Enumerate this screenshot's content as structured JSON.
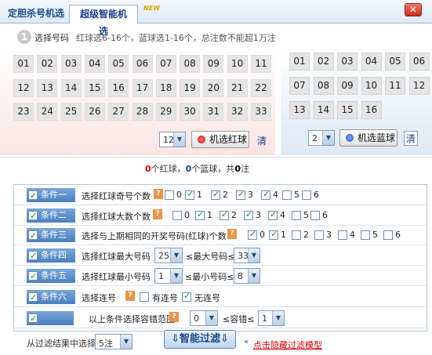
{
  "tabs": {
    "tab1": "定胆杀号机选",
    "tab2": "超级智能机选",
    "new_badge": "NEW"
  },
  "step": {
    "number": "1",
    "title": "选择号码",
    "desc": "红球选6-16个，蓝球选1-16个，总注数不能超1万注"
  },
  "red_balls": [
    "01",
    "02",
    "03",
    "04",
    "05",
    "06",
    "07",
    "08",
    "09",
    "10",
    "11",
    "12",
    "13",
    "14",
    "15",
    "16",
    "17",
    "18",
    "19",
    "20",
    "21",
    "22",
    "23",
    "24",
    "25",
    "26",
    "27",
    "28",
    "29",
    "30",
    "31",
    "32",
    "33"
  ],
  "blue_balls": [
    "01",
    "02",
    "03",
    "04",
    "05",
    "06",
    "07",
    "08",
    "09",
    "10",
    "11",
    "12",
    "13",
    "14",
    "15",
    "16"
  ],
  "red_select": {
    "value": "12",
    "button": "机选红球",
    "clear": "清"
  },
  "blue_select": {
    "value": "2",
    "button": "机选蓝球",
    "clear": "清"
  },
  "summary": {
    "red_count": "0",
    "red_label": "个红球，",
    "blue_count": "0",
    "blue_label": "个篮球，共",
    "total": "0",
    "unit": "注"
  },
  "conditions": [
    {
      "tag": "条件一",
      "text": "选择红球奇号个数",
      "options": [
        "0",
        "1",
        "2",
        "3",
        "4",
        "5",
        "6"
      ],
      "checked": [
        false,
        true,
        true,
        true,
        true,
        false,
        false
      ]
    },
    {
      "tag": "条件二",
      "text": "选择红球大数个数",
      "options": [
        "0",
        "1",
        "2",
        "3",
        "4",
        "5",
        "6"
      ],
      "checked": [
        false,
        true,
        true,
        true,
        true,
        false,
        false
      ]
    },
    {
      "tag": "条件三",
      "text": "选择与上期相同的开奖号码(红球)个数",
      "options": [
        "0",
        "1",
        "2",
        "3",
        "4",
        "5",
        "6"
      ],
      "checked": [
        true,
        true,
        false,
        false,
        false,
        false,
        false
      ]
    },
    {
      "tag": "条件四",
      "text": "选择红球最大号码",
      "min": "25",
      "mid": "≤最大号码≤",
      "max": "33"
    },
    {
      "tag": "条件五",
      "text": "选择红球最小号码",
      "min": "1",
      "mid": "≤最小号码≤",
      "max": "8"
    },
    {
      "tag": "条件六",
      "text": "选择连号",
      "opt_a": "有连号",
      "opt_b": "无连号"
    },
    {
      "text": "以上条件选择容错范围",
      "min": "0",
      "mid": "≤容错≤",
      "max": "1"
    }
  ],
  "help_mark": "?",
  "bottom": {
    "label": "从过滤结果中选择",
    "select": "5注",
    "filter_button": "智能过滤",
    "hide_link": "点击隐藏过滤模型"
  },
  "colors": {
    "accent_blue": "#4b7fc1",
    "red_text": "#e00000",
    "panel_red": "#fbe4e4",
    "panel_blue": "#dde9f6"
  }
}
